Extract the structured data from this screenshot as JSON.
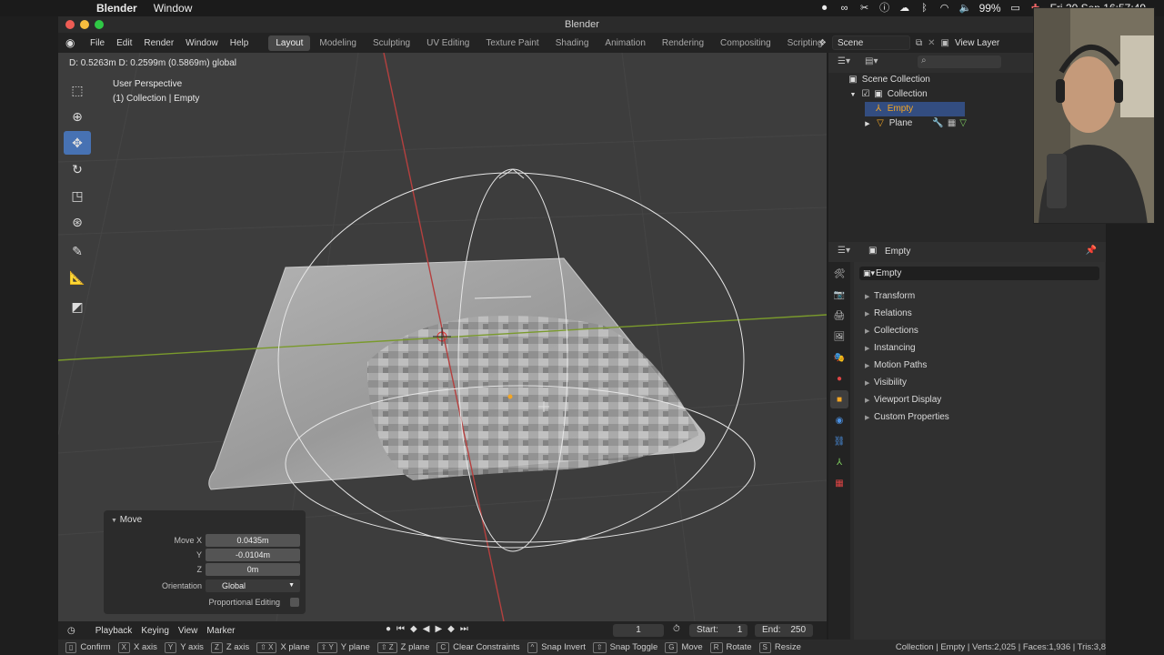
{
  "mac_menubar": {
    "app_name": "Blender",
    "menu": "Window",
    "battery": "99%",
    "datetime": "Fri 20 Sep  16:57:49"
  },
  "window": {
    "title": "Blender"
  },
  "topbar": {
    "menus": [
      "File",
      "Edit",
      "Render",
      "Window",
      "Help"
    ],
    "workspaces": [
      "Layout",
      "Modeling",
      "Sculpting",
      "UV Editing",
      "Texture Paint",
      "Shading",
      "Animation",
      "Rendering",
      "Compositing",
      "Scripting"
    ],
    "active_workspace": "Layout",
    "scene": "Scene",
    "view_layer": "View Layer"
  },
  "viewport": {
    "header_text": "D: 0.5263m   D: 0.2599m (0.5869m) global",
    "view_name": "User Perspective",
    "view_context": "(1) Collection | Empty",
    "colors": {
      "x_axis": "#b5403f",
      "y_axis": "#7a9a2c",
      "background": "#3d3d3d"
    }
  },
  "toolbar": {
    "tools": [
      "select-box",
      "cursor",
      "move",
      "rotate",
      "scale",
      "transform",
      "annotate",
      "measure",
      "add-cube"
    ],
    "active_tool": "move"
  },
  "move_panel": {
    "title": "Move",
    "move_x_label": "Move X",
    "move_x": "0.0435m",
    "y_label": "Y",
    "y": "-0.0104m",
    "z_label": "Z",
    "z": "0m",
    "orientation_label": "Orientation",
    "orientation": "Global",
    "proportional_label": "Proportional Editing"
  },
  "timeline": {
    "menus": [
      "Playback",
      "Keying",
      "View",
      "Marker"
    ],
    "current_frame": "1",
    "start_label": "Start:",
    "start": "1",
    "end_label": "End:",
    "end": "250"
  },
  "statusbar": {
    "hints": [
      {
        "key": "",
        "label": "Confirm"
      },
      {
        "key": "X",
        "label": "X axis"
      },
      {
        "key": "Y",
        "label": "Y axis"
      },
      {
        "key": "Z",
        "label": "Z axis"
      },
      {
        "key": "⇧ X",
        "label": "X plane"
      },
      {
        "key": "⇧ Y",
        "label": "Y plane"
      },
      {
        "key": "⇧ Z",
        "label": "Z plane"
      },
      {
        "key": "C",
        "label": "Clear Constraints"
      },
      {
        "key": "^",
        "label": "Snap Invert"
      },
      {
        "key": "⇧",
        "label": "Snap Toggle"
      },
      {
        "key": "G",
        "label": "Move"
      },
      {
        "key": "R",
        "label": "Rotate"
      },
      {
        "key": "S",
        "label": "Resize"
      }
    ],
    "stats": "Collection | Empty | Verts:2,025 | Faces:1,936 | Tris:3,8"
  },
  "outliner": {
    "root": "Scene Collection",
    "collection": "Collection",
    "items": [
      "Empty",
      "Plane"
    ],
    "selected": "Empty"
  },
  "properties": {
    "header_object": "Empty",
    "name_field": "Empty",
    "sections": [
      "Transform",
      "Relations",
      "Collections",
      "Instancing",
      "Motion Paths",
      "Visibility",
      "Viewport Display",
      "Custom Properties"
    ]
  }
}
